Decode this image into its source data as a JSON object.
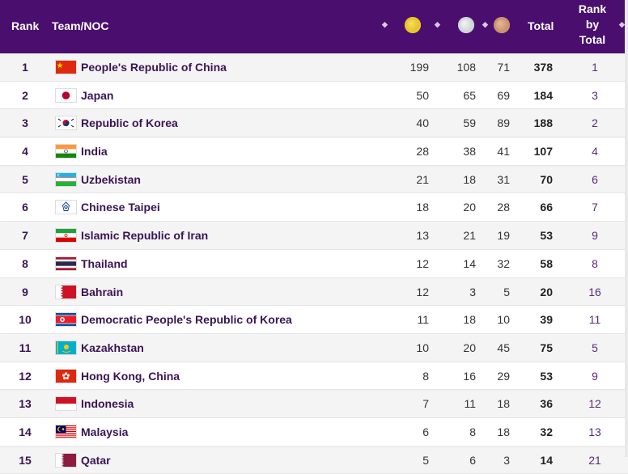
{
  "header": {
    "rank": "Rank",
    "team": "Team/NOC",
    "total": "Total",
    "rank_by_total": [
      "Rank",
      "by",
      "Total"
    ],
    "sort_glyph": "◆",
    "medal_icons": [
      "gold-medal-icon",
      "silver-medal-icon",
      "bronze-medal-icon"
    ]
  },
  "colors": {
    "header_bg": "#4a0f6e",
    "team_text": "#3a1454"
  },
  "rows": [
    {
      "rank": "1",
      "team": "People's Republic of China",
      "flag": "cn",
      "gold": "199",
      "silver": "108",
      "bronze": "71",
      "total": "378",
      "rank_by_total": "1"
    },
    {
      "rank": "2",
      "team": "Japan",
      "flag": "jp",
      "gold": "50",
      "silver": "65",
      "bronze": "69",
      "total": "184",
      "rank_by_total": "3"
    },
    {
      "rank": "3",
      "team": "Republic of Korea",
      "flag": "kr",
      "gold": "40",
      "silver": "59",
      "bronze": "89",
      "total": "188",
      "rank_by_total": "2"
    },
    {
      "rank": "4",
      "team": "India",
      "flag": "in",
      "gold": "28",
      "silver": "38",
      "bronze": "41",
      "total": "107",
      "rank_by_total": "4"
    },
    {
      "rank": "5",
      "team": "Uzbekistan",
      "flag": "uz",
      "gold": "21",
      "silver": "18",
      "bronze": "31",
      "total": "70",
      "rank_by_total": "6"
    },
    {
      "rank": "6",
      "team": "Chinese Taipei",
      "flag": "tpe",
      "gold": "18",
      "silver": "20",
      "bronze": "28",
      "total": "66",
      "rank_by_total": "7"
    },
    {
      "rank": "7",
      "team": "Islamic Republic of Iran",
      "flag": "ir",
      "gold": "13",
      "silver": "21",
      "bronze": "19",
      "total": "53",
      "rank_by_total": "9"
    },
    {
      "rank": "8",
      "team": "Thailand",
      "flag": "th",
      "gold": "12",
      "silver": "14",
      "bronze": "32",
      "total": "58",
      "rank_by_total": "8"
    },
    {
      "rank": "9",
      "team": "Bahrain",
      "flag": "bh",
      "gold": "12",
      "silver": "3",
      "bronze": "5",
      "total": "20",
      "rank_by_total": "16"
    },
    {
      "rank": "10",
      "team": "Democratic People's Republic of Korea",
      "flag": "kp",
      "gold": "11",
      "silver": "18",
      "bronze": "10",
      "total": "39",
      "rank_by_total": "11"
    },
    {
      "rank": "11",
      "team": "Kazakhstan",
      "flag": "kz",
      "gold": "10",
      "silver": "20",
      "bronze": "45",
      "total": "75",
      "rank_by_total": "5"
    },
    {
      "rank": "12",
      "team": "Hong Kong, China",
      "flag": "hk",
      "gold": "8",
      "silver": "16",
      "bronze": "29",
      "total": "53",
      "rank_by_total": "9"
    },
    {
      "rank": "13",
      "team": "Indonesia",
      "flag": "id",
      "gold": "7",
      "silver": "11",
      "bronze": "18",
      "total": "36",
      "rank_by_total": "12"
    },
    {
      "rank": "14",
      "team": "Malaysia",
      "flag": "my",
      "gold": "6",
      "silver": "8",
      "bronze": "18",
      "total": "32",
      "rank_by_total": "13"
    },
    {
      "rank": "15",
      "team": "Qatar",
      "flag": "qa",
      "gold": "5",
      "silver": "6",
      "bronze": "3",
      "total": "14",
      "rank_by_total": "21"
    }
  ]
}
